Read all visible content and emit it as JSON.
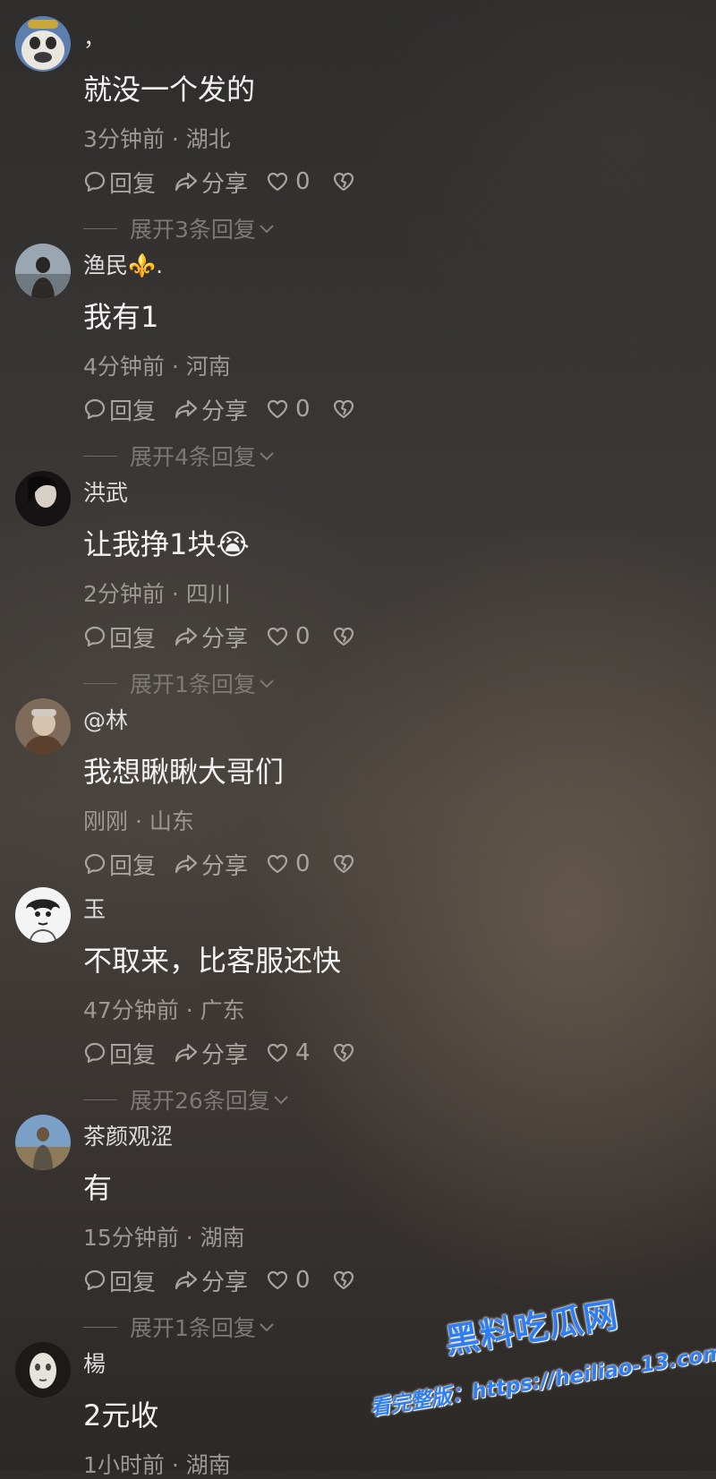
{
  "comments": [
    {
      "username": "，",
      "text": "就没一个发的",
      "meta": "3分钟前 · 湖北",
      "reply_label": "回复",
      "share_label": "分享",
      "likes": "0",
      "expand_label": "展开3条回复"
    },
    {
      "username": "渔民⚜️.",
      "text": "我有1",
      "meta": "4分钟前 · 河南",
      "reply_label": "回复",
      "share_label": "分享",
      "likes": "0",
      "expand_label": "展开4条回复"
    },
    {
      "username": "洪武",
      "text": "让我挣1块😭",
      "meta": "2分钟前 · 四川",
      "reply_label": "回复",
      "share_label": "分享",
      "likes": "0",
      "expand_label": "展开1条回复"
    },
    {
      "username": "@林",
      "text": "我想瞅瞅大哥们",
      "meta": "刚刚 · 山东",
      "reply_label": "回复",
      "share_label": "分享",
      "likes": "0"
    },
    {
      "username": "玉",
      "text": "不取来，比客服还快",
      "meta": "47分钟前 · 广东",
      "reply_label": "回复",
      "share_label": "分享",
      "likes": "4",
      "expand_label": "展开26条回复"
    },
    {
      "username": "茶颜观涩",
      "text": "有",
      "meta": "15分钟前 · 湖南",
      "reply_label": "回复",
      "share_label": "分享",
      "likes": "0",
      "expand_label": "展开1条回复"
    },
    {
      "username": "楊",
      "text": "2元收",
      "meta": "1小时前 · 湖南"
    }
  ],
  "watermark": {
    "title": "黑料吃瓜网",
    "url": "看完整版：https://heiliao-13.com"
  },
  "icons": {
    "reply": "comment-bubble-icon",
    "share": "share-arrow-icon",
    "like": "heart-icon",
    "dislike": "broken-heart-icon",
    "expand": "chevron-down-icon"
  },
  "colors": {
    "watermark_blue": "#2f7df2",
    "meta_gray": "#9c9894"
  }
}
